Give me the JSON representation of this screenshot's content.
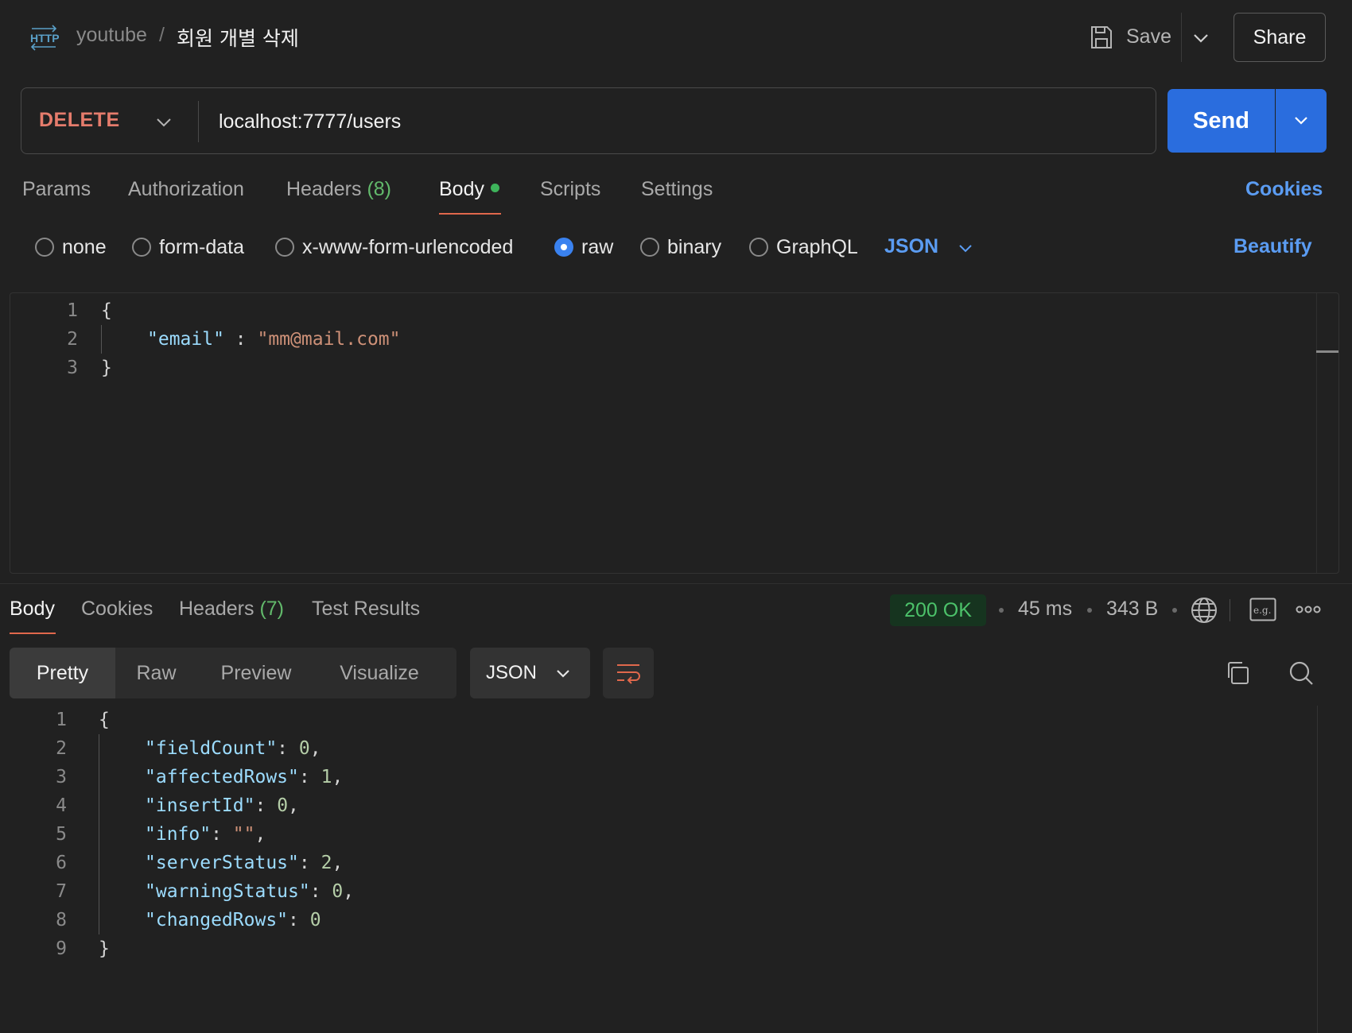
{
  "header": {
    "collection": "youtube",
    "separator": "/",
    "title": "회원 개별 삭제",
    "save_label": "Save",
    "share_label": "Share"
  },
  "request": {
    "method": "DELETE",
    "url": "localhost:7777/users",
    "send_label": "Send",
    "tabs": {
      "params": "Params",
      "authorization": "Authorization",
      "headers": "Headers",
      "headers_count": "(8)",
      "body": "Body",
      "scripts": "Scripts",
      "settings": "Settings"
    },
    "cookies_label": "Cookies",
    "body_types": {
      "none": "none",
      "form_data": "form-data",
      "urlencoded": "x-www-form-urlencoded",
      "raw": "raw",
      "binary": "binary",
      "graphql": "GraphQL"
    },
    "selected_body_type": "raw",
    "language": "JSON",
    "beautify_label": "Beautify",
    "body_lines": {
      "n1": "1",
      "n2": "2",
      "n3": "3",
      "open": "{",
      "key": "\"email\"",
      "sep": " : ",
      "value": "\"mm@mail.com\"",
      "close": "}"
    }
  },
  "response": {
    "tabs": {
      "body": "Body",
      "cookies": "Cookies",
      "headers": "Headers",
      "headers_count": "(7)",
      "test_results": "Test Results"
    },
    "status": "200 OK",
    "time": "45 ms",
    "size": "343 B",
    "views": {
      "pretty": "Pretty",
      "raw": "Raw",
      "preview": "Preview",
      "visualize": "Visualize"
    },
    "format": "JSON",
    "lines": [
      {
        "n": "1",
        "text": "{"
      },
      {
        "n": "2",
        "key": "\"fieldCount\"",
        "value": "0",
        "trail": ","
      },
      {
        "n": "3",
        "key": "\"affectedRows\"",
        "value": "1",
        "trail": ","
      },
      {
        "n": "4",
        "key": "\"insertId\"",
        "value": "0",
        "trail": ","
      },
      {
        "n": "5",
        "key": "\"info\"",
        "value": "\"\"",
        "trail": ","
      },
      {
        "n": "6",
        "key": "\"serverStatus\"",
        "value": "2",
        "trail": ","
      },
      {
        "n": "7",
        "key": "\"warningStatus\"",
        "value": "0",
        "trail": ","
      },
      {
        "n": "8",
        "key": "\"changedRows\"",
        "value": "0",
        "trail": ""
      },
      {
        "n": "9",
        "text": "}"
      }
    ]
  },
  "icons": {
    "http": "http-icon",
    "save": "save-icon",
    "chevron": "chevron-down-icon",
    "globe": "globe-icon",
    "example": "example-icon",
    "more": "more-icon",
    "wrap": "wrap-icon",
    "copy": "copy-icon",
    "search": "search-icon"
  },
  "colors": {
    "background": "#212121",
    "accent_blue": "#2a6dde",
    "method_delete": "#e57c6c",
    "status_ok": "#4cc26a",
    "tab_underline": "#e0684c"
  }
}
